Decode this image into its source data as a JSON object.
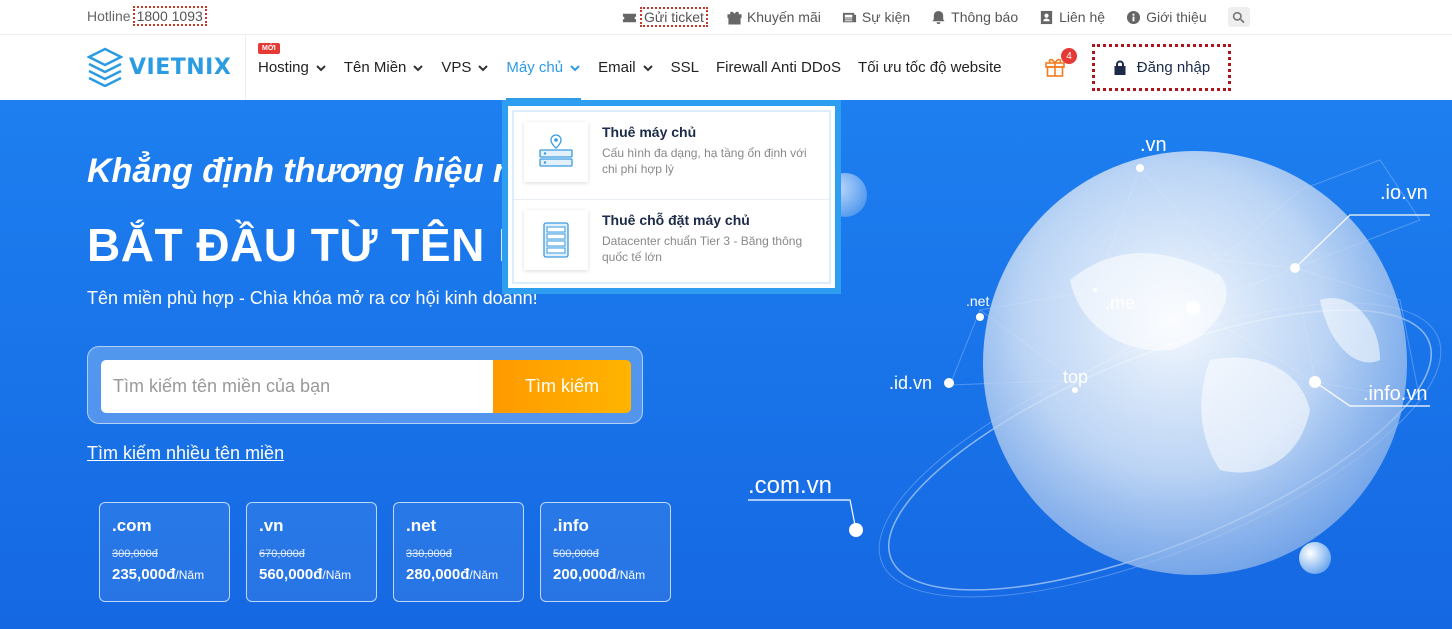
{
  "topbar": {
    "hotline_label": "Hotline",
    "hotline_number": "1800 1093",
    "links": [
      {
        "label": "Gửi ticket",
        "icon": "ticket-icon"
      },
      {
        "label": "Khuyến mãi",
        "icon": "gift-icon"
      },
      {
        "label": "Sự kiện",
        "icon": "newspaper-icon"
      },
      {
        "label": "Thông báo",
        "icon": "bell-icon"
      },
      {
        "label": "Liên hệ",
        "icon": "contact-card-icon"
      },
      {
        "label": "Giới thiệu",
        "icon": "info-icon"
      }
    ]
  },
  "logo": {
    "text": "VIETNIX"
  },
  "nav": {
    "new_badge": "MỚI",
    "items": [
      {
        "label": "Hosting",
        "dropdown": true
      },
      {
        "label": "Tên Miền",
        "dropdown": true
      },
      {
        "label": "VPS",
        "dropdown": true
      },
      {
        "label": "Máy chủ",
        "dropdown": true,
        "active": true
      },
      {
        "label": "Email",
        "dropdown": true
      },
      {
        "label": "SSL",
        "dropdown": false
      },
      {
        "label": "Firewall Anti DDoS",
        "dropdown": false
      },
      {
        "label": "Tối ưu tốc độ website",
        "dropdown": false
      }
    ],
    "gift_count": "4",
    "login_label": "Đăng nhập"
  },
  "dropdown": {
    "items": [
      {
        "title": "Thuê máy chủ",
        "desc": "Cấu hình đa dạng, hạ tầng ổn định với chi phí hợp lý",
        "icon": "server-location-icon"
      },
      {
        "title": "Thuê chỗ đặt máy chủ",
        "desc": "Datacenter chuẩn Tier 3 - Băng thông quốc tế lớn",
        "icon": "server-rack-icon"
      }
    ]
  },
  "hero": {
    "tagline": "Khẳng định thương hiệu m",
    "title": "BẮT ĐẦU TỪ TÊN MI",
    "subtitle": "Tên miền phù hợp - Chìa khóa mở ra cơ hội kinh doanh!",
    "search_placeholder": "Tìm kiếm tên miền của bạn",
    "search_button": "Tìm kiếm",
    "multi_search": "Tìm kiếm nhiều tên miền",
    "tlds": [
      {
        "name": ".com",
        "old_price": "300,000đ",
        "price": "235,000đ",
        "unit": "/Năm"
      },
      {
        "name": ".vn",
        "old_price": "670,000đ",
        "price": "560,000đ",
        "unit": "/Năm"
      },
      {
        "name": ".net",
        "old_price": "330,000đ",
        "price": "280,000đ",
        "unit": "/Năm"
      },
      {
        "name": ".info",
        "old_price": "500,000đ",
        "price": "200,000đ",
        "unit": "/Năm"
      }
    ],
    "globe_labels": [
      ".vn",
      ".io.vn",
      ".net",
      ".me",
      "top",
      ".id.vn",
      ".info.vn",
      ".com.vn"
    ]
  },
  "colors": {
    "brand": "#2b9be3",
    "hero_bg": "#1d7ff0",
    "accent": "#ff9a00",
    "active_nav": "#2e9be6",
    "badge": "#e53935"
  }
}
